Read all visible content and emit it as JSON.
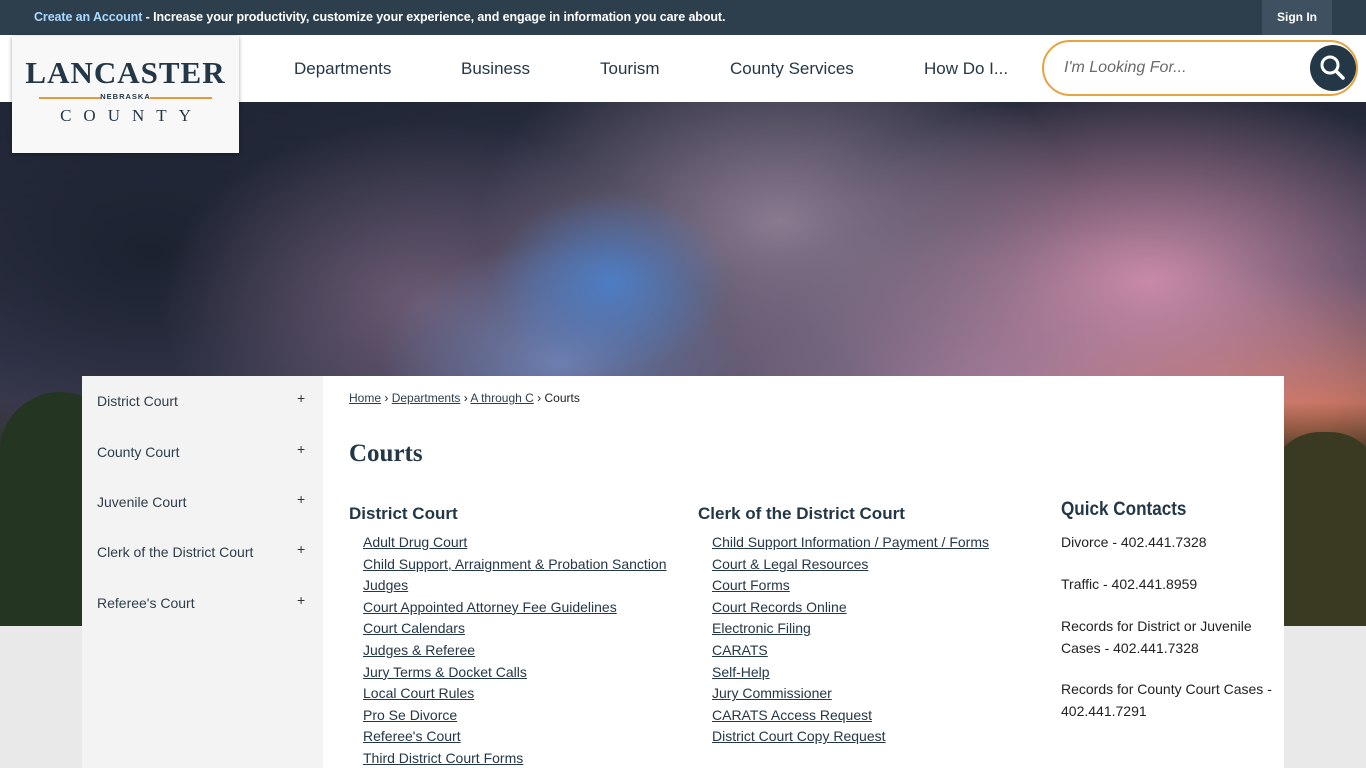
{
  "topbar": {
    "create_account": "Create an Account",
    "message": " - Increase your productivity, customize your experience, and engage in information you care about.",
    "sign_in": "Sign In"
  },
  "logo": {
    "line1": "LANCASTER",
    "line2": "NEBRASKA",
    "line3": "COUNTY"
  },
  "nav": [
    "Departments",
    "Business",
    "Tourism",
    "County Services",
    "How Do I..."
  ],
  "search": {
    "placeholder": "I'm Looking For..."
  },
  "sidebar": {
    "items": [
      {
        "label": "District Court",
        "toggle": "+"
      },
      {
        "label": "County Court",
        "toggle": "+"
      },
      {
        "label": "Juvenile Court",
        "toggle": "+"
      },
      {
        "label": "Clerk of the District Court",
        "toggle": "+"
      },
      {
        "label": "Referee's Court",
        "toggle": "+"
      }
    ]
  },
  "breadcrumb": {
    "home": "Home",
    "departments": "Departments",
    "a_through_c": "A through C",
    "current": "Courts",
    "sep": "›"
  },
  "page_title": "Courts",
  "district_court": {
    "heading": "District Court",
    "links": [
      "Adult Drug Court",
      "Child Support, Arraignment & Probation Sanction",
      "Judges",
      "Court Appointed Attorney Fee Guidelines",
      "Court Calendars",
      "Judges & Referee",
      "Jury Terms & Docket Calls",
      "Local Court Rules",
      "Pro Se Divorce",
      "Referee's Court",
      "Third District Court Forms"
    ]
  },
  "clerk_court": {
    "heading": "Clerk of the District Court",
    "links": [
      "Child Support Information / Payment / Forms",
      "Court & Legal Resources",
      "Court Forms",
      "Court Records Online",
      "Electronic Filing",
      "CARATS",
      "Self-Help",
      "Jury Commissioner",
      "CARATS Access Request",
      "District Court Copy Request"
    ]
  },
  "quick_contacts": {
    "title": "Quick Contacts",
    "items": [
      "Divorce - 402.441.7328",
      "Traffic - 402.441.8959",
      "Records for District or Juvenile Cases - 402.441.7328",
      "Records for County Court Cases - 402.441.7291"
    ]
  }
}
